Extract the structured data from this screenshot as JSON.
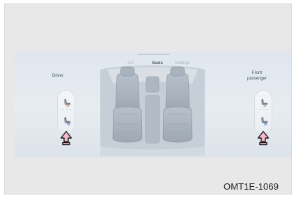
{
  "tabs": [
    {
      "label": "A/C",
      "active": false
    },
    {
      "label": "Seats",
      "active": true
    },
    {
      "label": "Settings",
      "active": false
    }
  ],
  "driver": {
    "label": "Driver",
    "upper_icon": "seat-heat-icon",
    "lower_icon": "seat-vent-icon"
  },
  "passenger": {
    "label": "Front passenger",
    "upper_icon": "seat-heat-icon",
    "lower_icon": "seat-vent-icon"
  },
  "markers": {
    "icon": "up-arrow-icon",
    "color": "#f7b9c9",
    "outline": "#1a1a1a"
  },
  "colors": {
    "screen": "#dfe6ee",
    "accent": "#4f87d8"
  },
  "caption": "OMT1E-1069"
}
